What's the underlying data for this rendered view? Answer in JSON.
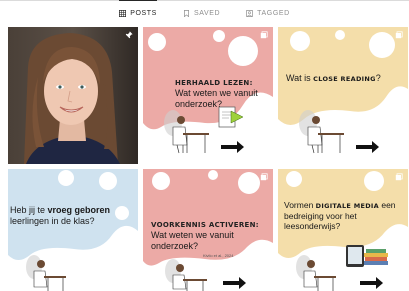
{
  "tabs": [
    {
      "label": "POSTS",
      "icon": "grid-icon",
      "active": true
    },
    {
      "label": "SAVED",
      "icon": "bookmark-icon",
      "active": false
    },
    {
      "label": "TAGGED",
      "icon": "tag-icon",
      "active": false
    }
  ],
  "posts": [
    {
      "type": "photo",
      "icon": "pin-icon"
    },
    {
      "heading": "Herhaald lezen:",
      "text": "Wat weten we vanuit onderzoek?",
      "bg": "#ecaaa6"
    },
    {
      "text_pre": "Wat is ",
      "highlight": "close reading",
      "text_post": "?",
      "bg": "#f4deaa"
    },
    {
      "text_pre": "Heb jij te ",
      "highlight": "vroeg geboren",
      "text_post": " leerlingen in de klas?",
      "bg": "#cfe2ef"
    },
    {
      "heading": "Voorkennis activeren:",
      "text": "Wat weten we vanuit onderzoek?",
      "caption": "Kivilo et al., 2024",
      "bg": "#ecaaa6"
    },
    {
      "text_pre": "Vormen ",
      "highlight": "digitale media",
      "text_post": " een bedreiging voor het leesonderwijs?",
      "bg": "#f4deaa"
    }
  ],
  "colors": {
    "pink": "#ecaaa6",
    "yellow": "#f4deaa",
    "blue": "#cfe2ef",
    "accent": "#262626"
  }
}
